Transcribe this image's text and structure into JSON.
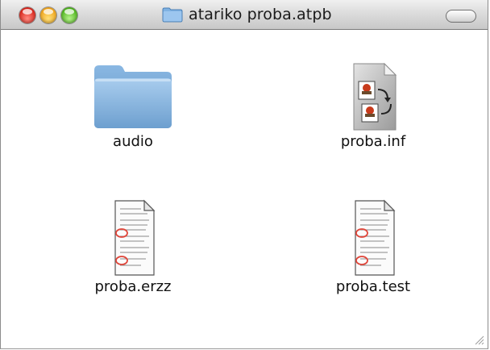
{
  "window": {
    "title": "atariko proba.atpb",
    "title_icon": "folder-icon"
  },
  "items": [
    {
      "label": "audio",
      "icon": "folder-icon"
    },
    {
      "label": "proba.inf",
      "icon": "inf-document-icon"
    },
    {
      "label": "proba.erzz",
      "icon": "text-document-icon"
    },
    {
      "label": "proba.test",
      "icon": "text-document-icon"
    }
  ]
}
